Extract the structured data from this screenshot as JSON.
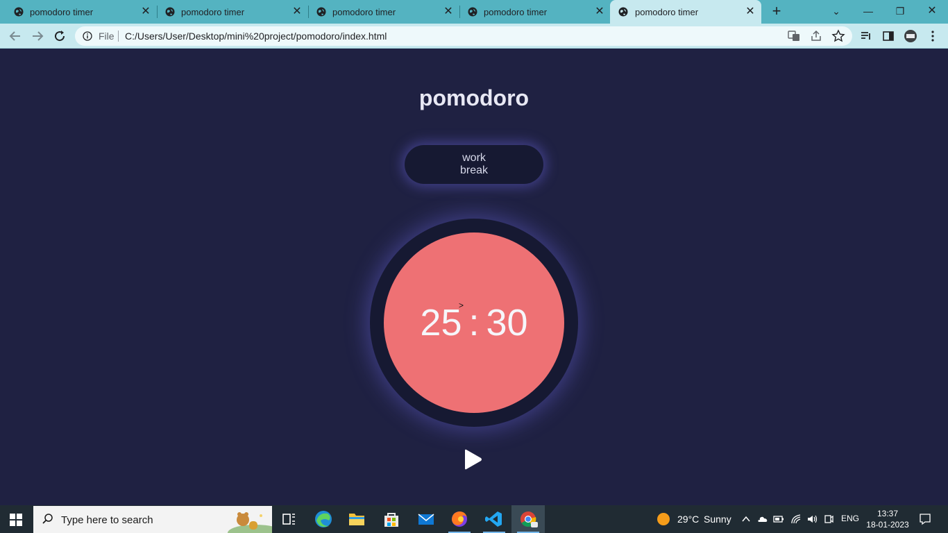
{
  "browser": {
    "tabs": [
      {
        "title": "pomodoro timer",
        "active": false
      },
      {
        "title": "pomodoro timer",
        "active": false
      },
      {
        "title": "pomodoro timer",
        "active": false
      },
      {
        "title": "pomodoro timer",
        "active": false
      },
      {
        "title": "pomodoro timer",
        "active": true
      }
    ],
    "address": {
      "scheme_label": "File",
      "url": "C:/Users/User/Desktop/mini%20project/pomodoro/index.html"
    }
  },
  "app": {
    "title": "pomodoro",
    "modes": [
      "work",
      "break"
    ],
    "timer": {
      "minutes": "25",
      "separator": ":",
      "seconds": "30"
    },
    "cursor_glyph": ">",
    "play_icon": "play-icon"
  },
  "taskbar": {
    "search_placeholder": "Type here to search",
    "weather": {
      "temp": "29°C",
      "condition": "Sunny"
    },
    "language": "ENG",
    "time": "13:37",
    "date": "18-01-2023"
  },
  "colors": {
    "page_bg": "#1f2142",
    "panel_bg": "#161932",
    "accent_red": "#ee7174",
    "tab_strip": "#54b3c1"
  }
}
